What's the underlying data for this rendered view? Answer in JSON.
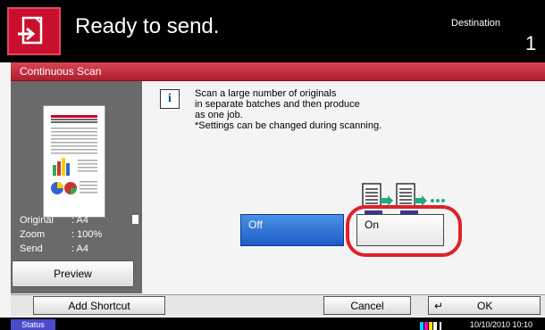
{
  "header": {
    "title": "Ready to send.",
    "destination_label": "Destination",
    "destination_count": "1"
  },
  "screen_title": "Continuous Scan",
  "preview_panel": {
    "rows": [
      {
        "label": "Original",
        "value": ": A4"
      },
      {
        "label": "Zoom",
        "value": ": 100%"
      },
      {
        "label": "Send",
        "value": ": A4"
      }
    ],
    "preview_button": "Preview"
  },
  "info": {
    "text": "Scan a large number of originals\nin separate batches and then produce\nas one job.\n*Settings can be changed during scanning."
  },
  "options": {
    "off_label": "Off",
    "on_label": "On",
    "selected": "Off"
  },
  "bottom": {
    "add_shortcut": "Add Shortcut",
    "cancel": "Cancel",
    "ok": "OK"
  },
  "status": {
    "status_label": "Status",
    "datetime": "10/10/2010  10:10"
  },
  "colors": {
    "accent_red": "#c8102e",
    "selected_blue": "#1e5cc8",
    "highlight_ring": "#e0202a"
  },
  "icons": {
    "send": "send-document-icon",
    "info": "info-icon",
    "continuous_scan": "continuous-scan-illustration"
  }
}
